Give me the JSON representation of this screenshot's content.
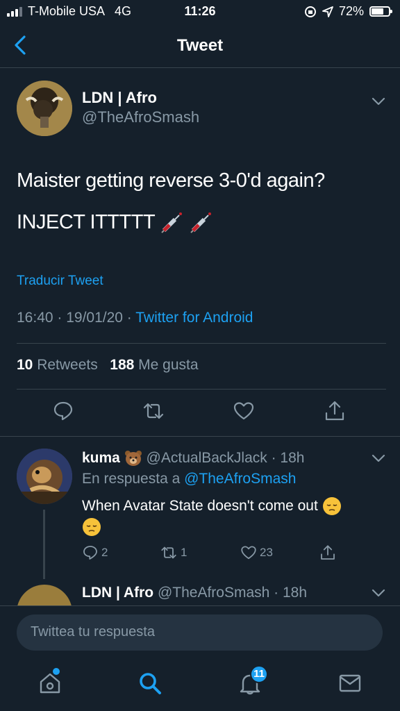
{
  "status_bar": {
    "carrier": "T-Mobile USA",
    "network": "4G",
    "time": "11:26",
    "battery": "72%",
    "battery_level": 0.72
  },
  "nav": {
    "title": "Tweet"
  },
  "tweet": {
    "author_name": "LDN | Afro",
    "author_handle": "@TheAfroSmash",
    "text_line1": "Maister getting reverse 3-0'd again?",
    "text_line2": "INJECT ITTTTT",
    "translate": "Traducir Tweet",
    "timestamp": "16:40 · 19/01/20 · ",
    "source": "Twitter for Android",
    "retweets_count": "10",
    "retweets_label": "Retweets",
    "likes_count": "188",
    "likes_label": "Me gusta"
  },
  "reply": {
    "name": "kuma",
    "handle_time": "@ActualBackJlack · 18h",
    "replying_to_label": "En respuesta a ",
    "replying_to": "@TheAfroSmash",
    "text": "When Avatar State doesn't come out",
    "reply_count": "2",
    "retweet_count": "1",
    "like_count": "23"
  },
  "reply2": {
    "name": "LDN | Afro",
    "handle_time": "@TheAfroSmash · 18h"
  },
  "composer": {
    "placeholder": "Twittea tu respuesta"
  },
  "tabs": {
    "notifications_badge": "11"
  },
  "colors": {
    "background": "#15202b",
    "accent": "#1da1f2",
    "muted": "#8899a6",
    "border": "#38444d"
  }
}
